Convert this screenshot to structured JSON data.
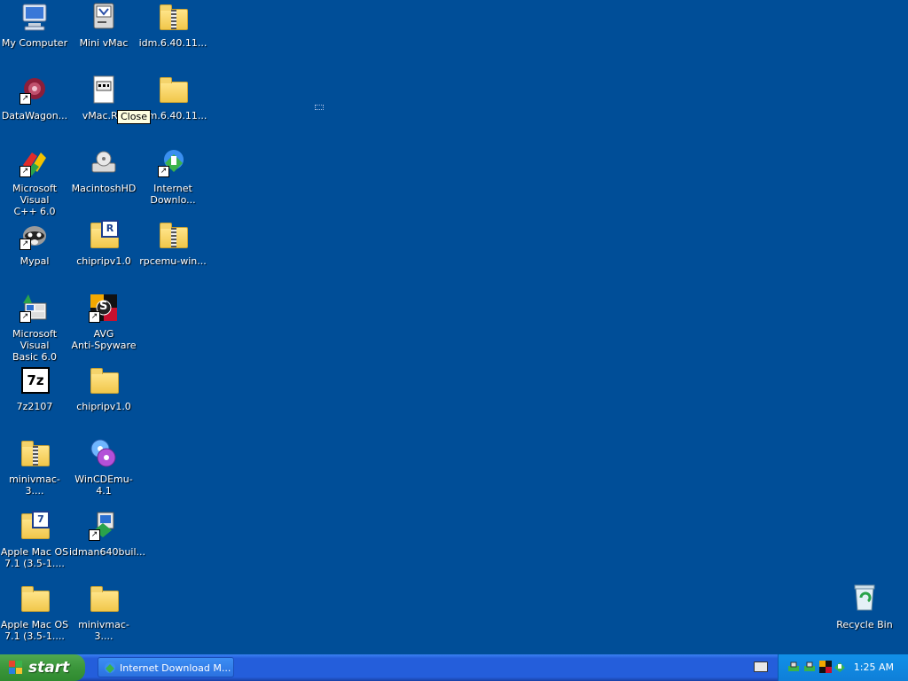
{
  "desktop": {
    "icons": [
      {
        "label": "My Computer"
      },
      {
        "label": "Mini vMac"
      },
      {
        "label": "idm.6.40.11..."
      },
      {
        "label": "DataWagon..."
      },
      {
        "label": "vMac.RO"
      },
      {
        "label": "idm.6.40.11..."
      },
      {
        "label": "Microsoft Visual\nC++ 6.0"
      },
      {
        "label": "MacintoshHD"
      },
      {
        "label": "Internet\nDownlo..."
      },
      {
        "label": "Mypal"
      },
      {
        "label": "chipripv1.0",
        "badge": "R"
      },
      {
        "label": "rpcemu-win..."
      },
      {
        "label": "Microsoft Visual\nBasic 6.0"
      },
      {
        "label": "AVG\nAnti-Spyware",
        "badge": "S"
      },
      {
        "label": "7z2107",
        "badge": "7z"
      },
      {
        "label": "chipripv1.0"
      },
      {
        "label": "minivmac-3...."
      },
      {
        "label": "WinCDEmu-4.1"
      },
      {
        "label": "Apple Mac OS\n7.1 (3.5-1....",
        "badge": "7"
      },
      {
        "label": "idman640buil..."
      },
      {
        "label": "Apple Mac OS\n7.1 (3.5-1...."
      },
      {
        "label": "minivmac-3...."
      },
      {
        "label": "Recycle Bin"
      }
    ],
    "tooltip": "Close"
  },
  "taskbar": {
    "start_label": "start",
    "task_button": "Internet Download M...",
    "clock": "1:25 AM"
  }
}
